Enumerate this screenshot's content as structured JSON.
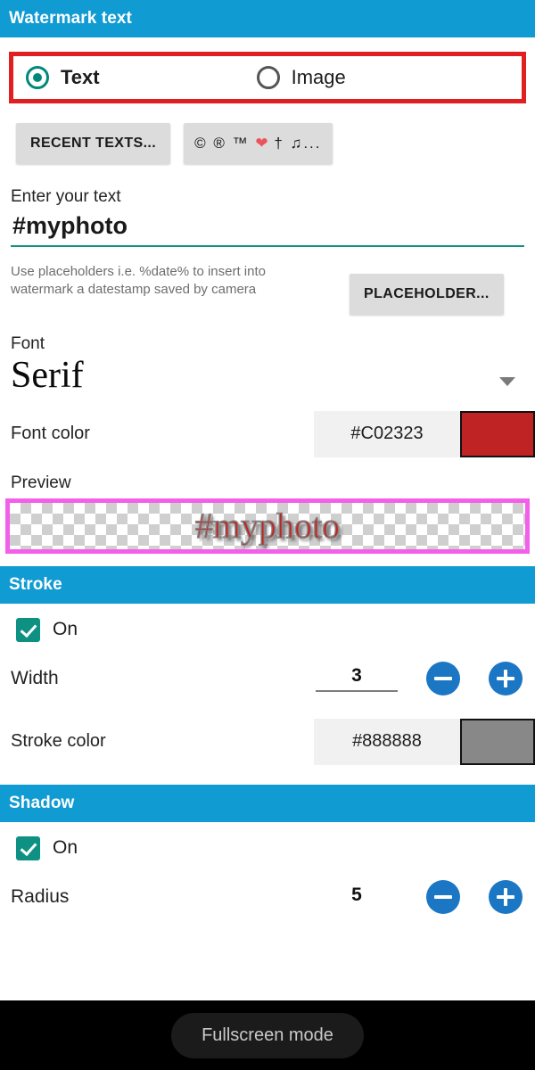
{
  "sections": {
    "watermark_text": "Watermark text",
    "stroke": "Stroke",
    "shadow": "Shadow"
  },
  "type_selector": {
    "text_option": "Text",
    "image_option": "Image",
    "selected": "Text",
    "highlight_color": "#E02020"
  },
  "buttons": {
    "recent_texts": "RECENT TEXTS...",
    "symbols_copyright": "©",
    "symbols_registered": "®",
    "symbols_trademark": "™",
    "symbols_heart": "❤",
    "symbols_cross": "†",
    "symbols_note": "♫",
    "symbols_ellipsis": "...",
    "placeholders": "PLACEHOLDER..."
  },
  "text_field": {
    "label": "Enter your text",
    "value": "#myphoto",
    "placeholder": "Enter your text",
    "underline_color": "#15907F"
  },
  "hint": {
    "line1": "Use placeholders i.e. %date% to insert into",
    "line2": "watermark a datestamp saved by camera"
  },
  "font": {
    "label": "Font",
    "value": "Serif"
  },
  "font_color": {
    "label": "Font color",
    "hex": "#C02323"
  },
  "preview": {
    "label": "Preview",
    "text": "#myphoto",
    "border_color": "#F45FEA"
  },
  "stroke_settings": {
    "toggle_label": "On",
    "toggle_on": true,
    "width_label": "Width",
    "width_value": "3",
    "color_label": "Stroke color",
    "color_hex": "#888888"
  },
  "shadow_settings": {
    "toggle_label": "On",
    "toggle_on": true,
    "radius_label": "Radius",
    "radius_value": "5"
  },
  "bottom_nav": {
    "fullscreen_label": "Fullscreen mode"
  },
  "theme": {
    "section_bar": "#109BD2",
    "accent_teal": "#0E9183",
    "stepper_blue": "#1B77C4"
  }
}
